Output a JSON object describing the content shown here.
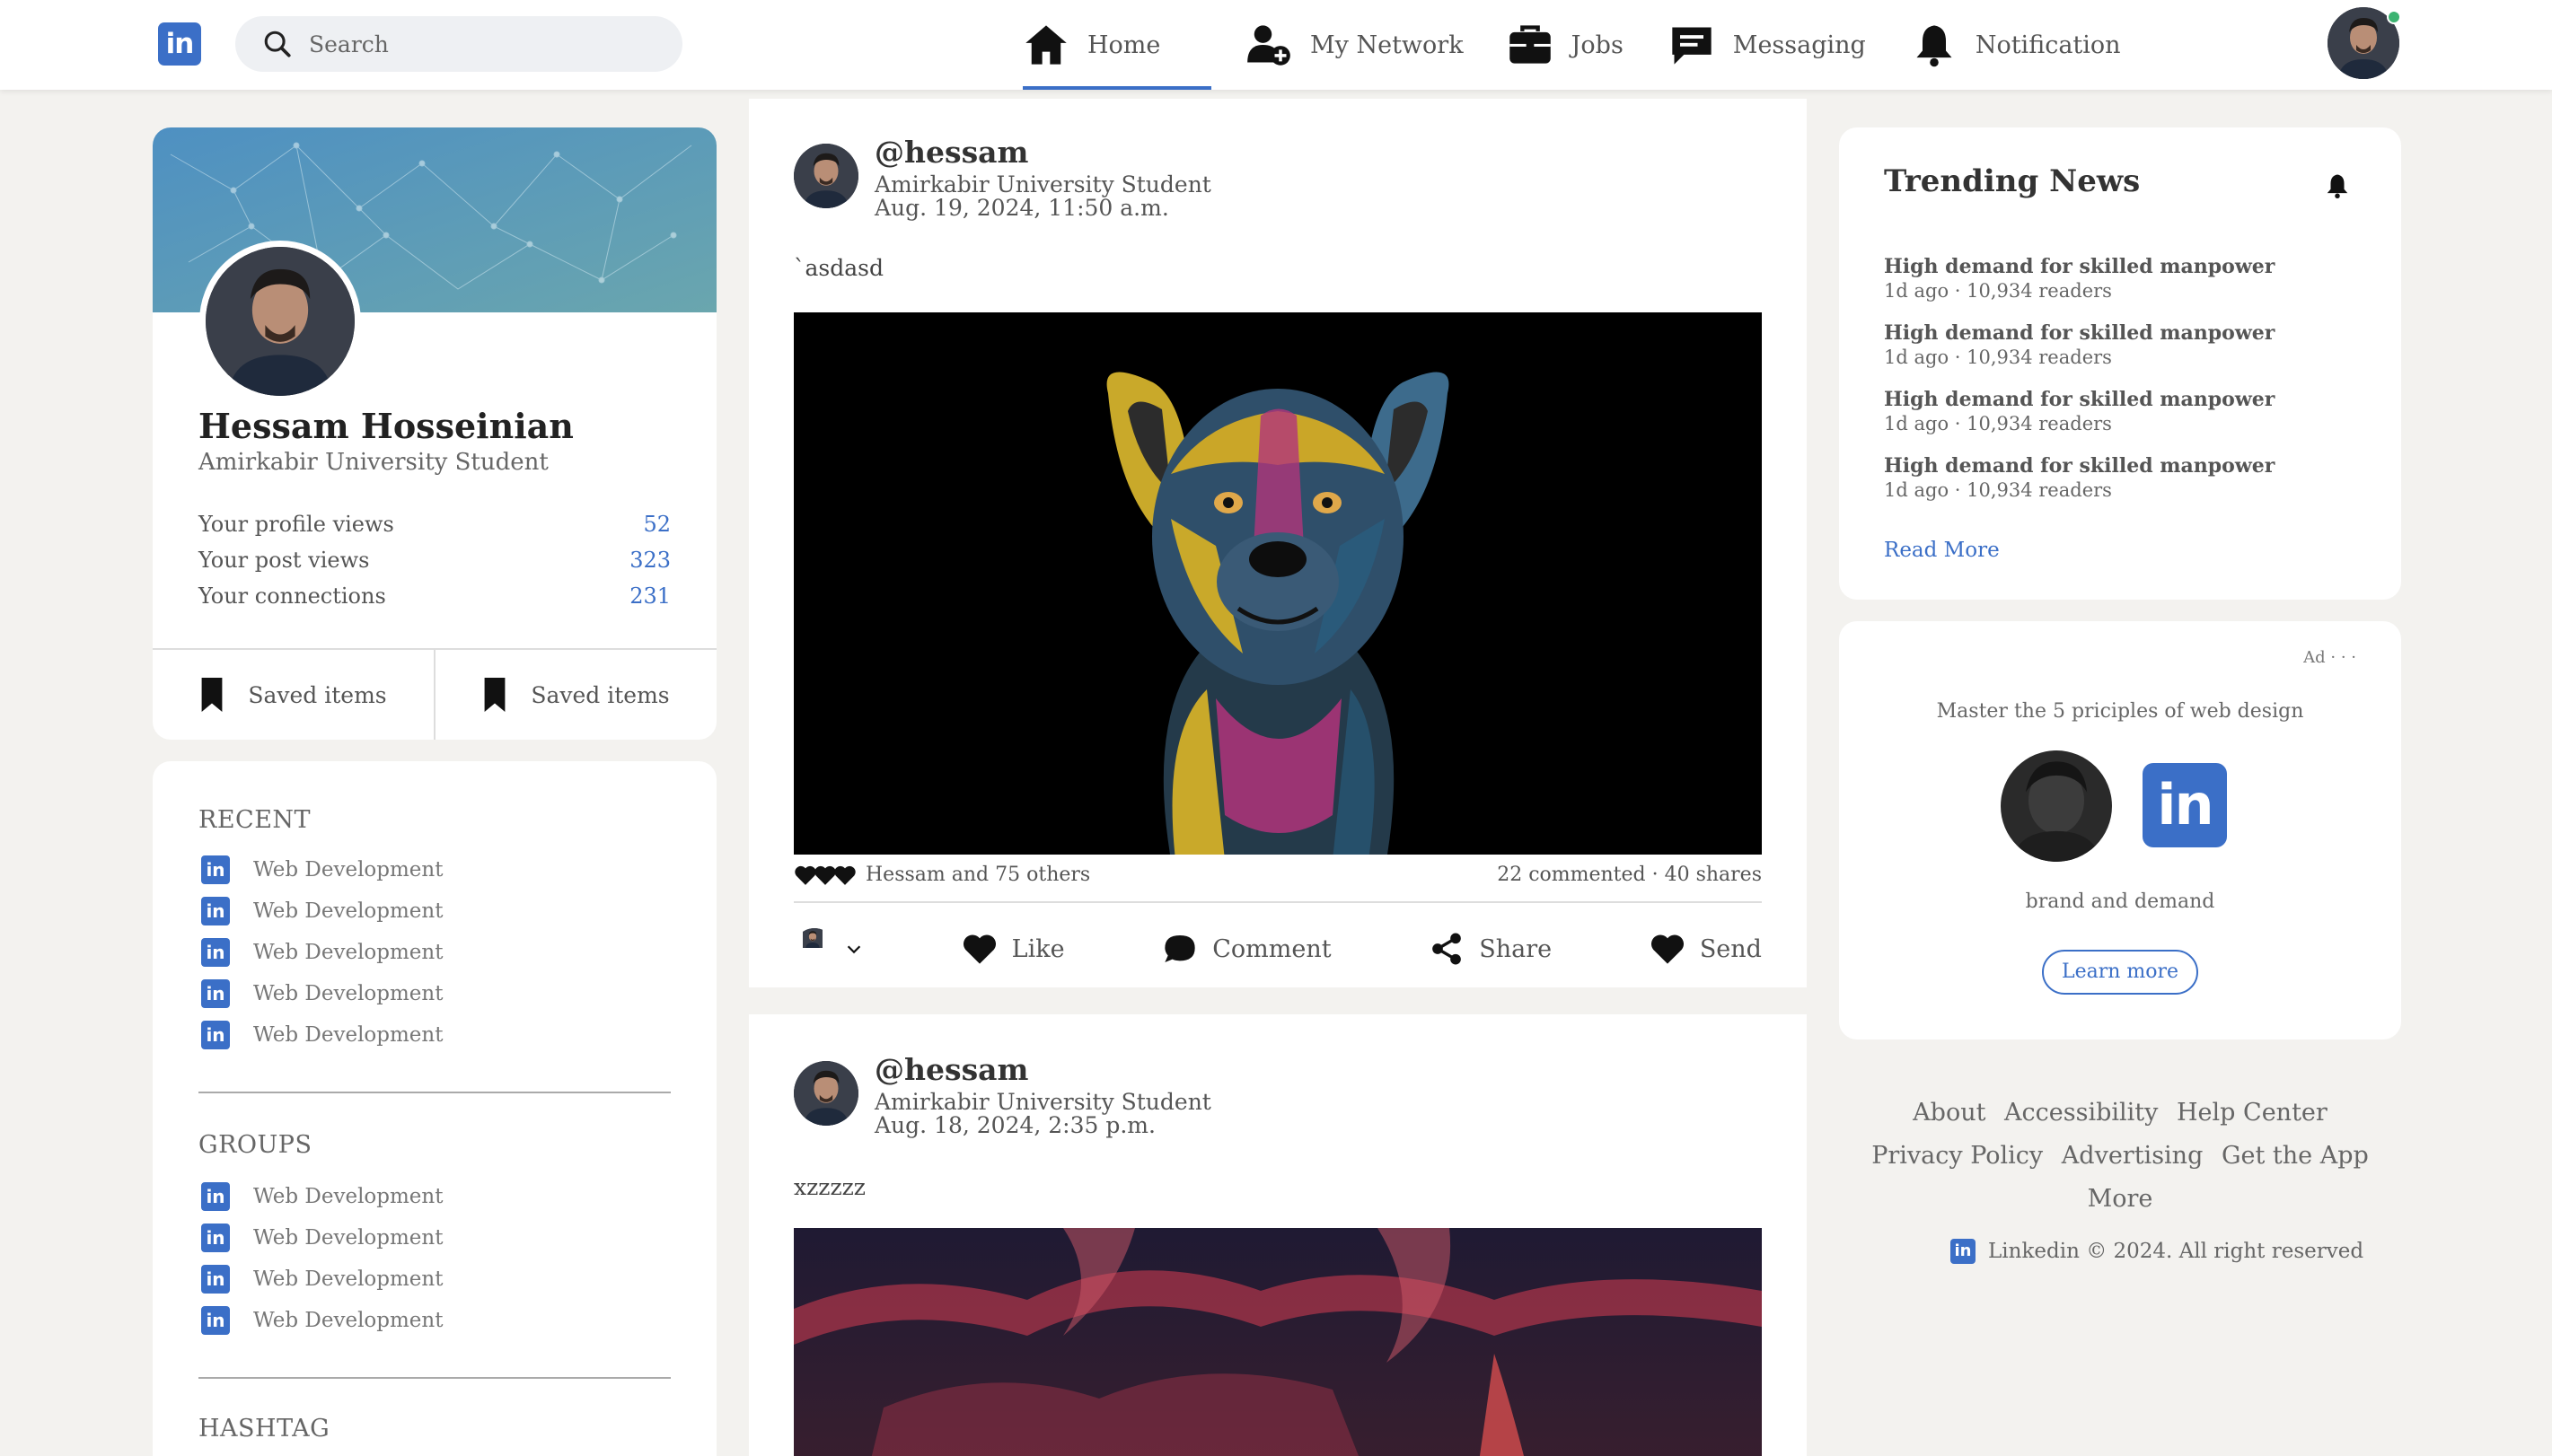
{
  "header": {
    "logo_text": "in",
    "search_placeholder": "Search",
    "nav": [
      {
        "label": "Home",
        "icon": "home-icon",
        "active": true
      },
      {
        "label": "My Network",
        "icon": "network-icon"
      },
      {
        "label": "Jobs",
        "icon": "briefcase-icon"
      },
      {
        "label": "Messaging",
        "icon": "message-icon"
      },
      {
        "label": "Notification",
        "icon": "bell-icon"
      }
    ],
    "online_color": "#3cb371"
  },
  "profile": {
    "name": "Hessam Hosseinian",
    "subtitle": "Amirkabir University Student",
    "stats": [
      {
        "label": "Your profile views",
        "value": "52"
      },
      {
        "label": "Your post views",
        "value": "323"
      },
      {
        "label": "Your connections",
        "value": "231"
      }
    ],
    "saved_left": "Saved items",
    "saved_right": "Saved items"
  },
  "sidebar": {
    "recent_title": "RECENT",
    "recent": [
      "Web Development",
      "Web Development",
      "Web Development",
      "Web Development",
      "Web Development"
    ],
    "groups_title": "GROUPS",
    "groups": [
      "Web Development",
      "Web Development",
      "Web Development",
      "Web Development"
    ],
    "hashtag_title": "HASHTAG"
  },
  "posts": [
    {
      "handle": "@hessam",
      "subtitle": "Amirkabir University Student",
      "date": "Aug. 19, 2024, 11:50 a.m.",
      "text": "`asdasd",
      "reactions": "Hessam and 75 others",
      "counts": "22 commented · 40 shares"
    },
    {
      "handle": "@hessam",
      "subtitle": "Amirkabir University Student",
      "date": "Aug. 18, 2024, 2:35 p.m.",
      "text": "xzzzzz"
    }
  ],
  "actions": {
    "like": "Like",
    "comment": "Comment",
    "share": "Share",
    "send": "Send"
  },
  "trending": {
    "title": "Trending News",
    "items": [
      {
        "title": "High demand for skilled manpower",
        "meta": "1d ago · 10,934 readers"
      },
      {
        "title": "High demand for skilled manpower",
        "meta": "1d ago · 10,934 readers"
      },
      {
        "title": "High demand for skilled manpower",
        "meta": "1d ago · 10,934 readers"
      },
      {
        "title": "High demand for skilled manpower",
        "meta": "1d ago · 10,934 readers"
      }
    ],
    "read_more": "Read More"
  },
  "ad": {
    "label": "Ad · · ·",
    "title": "Master the 5 priciples of web design",
    "logo_text": "in",
    "subtitle": "brand and demand",
    "cta": "Learn more"
  },
  "footer": {
    "links": [
      "About",
      "Accessibility",
      "Help Center",
      "Privacy Policy",
      "Advertising",
      "Get the App",
      "More"
    ],
    "copyright": "Linkedin © 2024. All right reserved"
  },
  "colors": {
    "accent": "#3b6fc7",
    "background": "#f3f2ef"
  }
}
